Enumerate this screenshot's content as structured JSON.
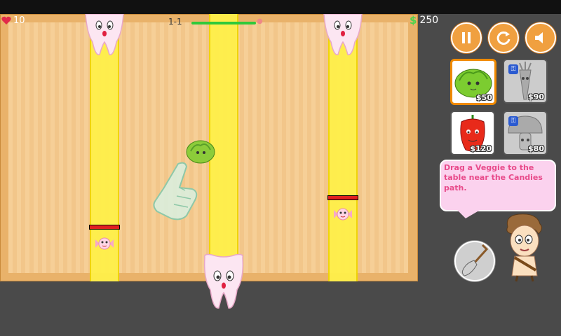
{
  "hud": {
    "lives": "10",
    "level": "1-1",
    "money_symbol": "$",
    "money": "250"
  },
  "buttons": {
    "pause_icon": "pause-icon",
    "restart_icon": "restart-icon",
    "sound_icon": "speaker-icon"
  },
  "shop": [
    {
      "name": "lettuce",
      "price": "$50",
      "locked": false
    },
    {
      "name": "carrot",
      "price": "$90",
      "locked": true
    },
    {
      "name": "pepper",
      "price": "$120",
      "locked": true
    },
    {
      "name": "mushroom",
      "price": "$80",
      "locked": true
    }
  ],
  "tutorial": {
    "message": "Drag a Veggie to the table near the Candies path."
  },
  "colors": {
    "board": "#f6cf97",
    "lane": "#fff04a",
    "accent": "#f0a040",
    "speech_text": "#e84a8a"
  }
}
